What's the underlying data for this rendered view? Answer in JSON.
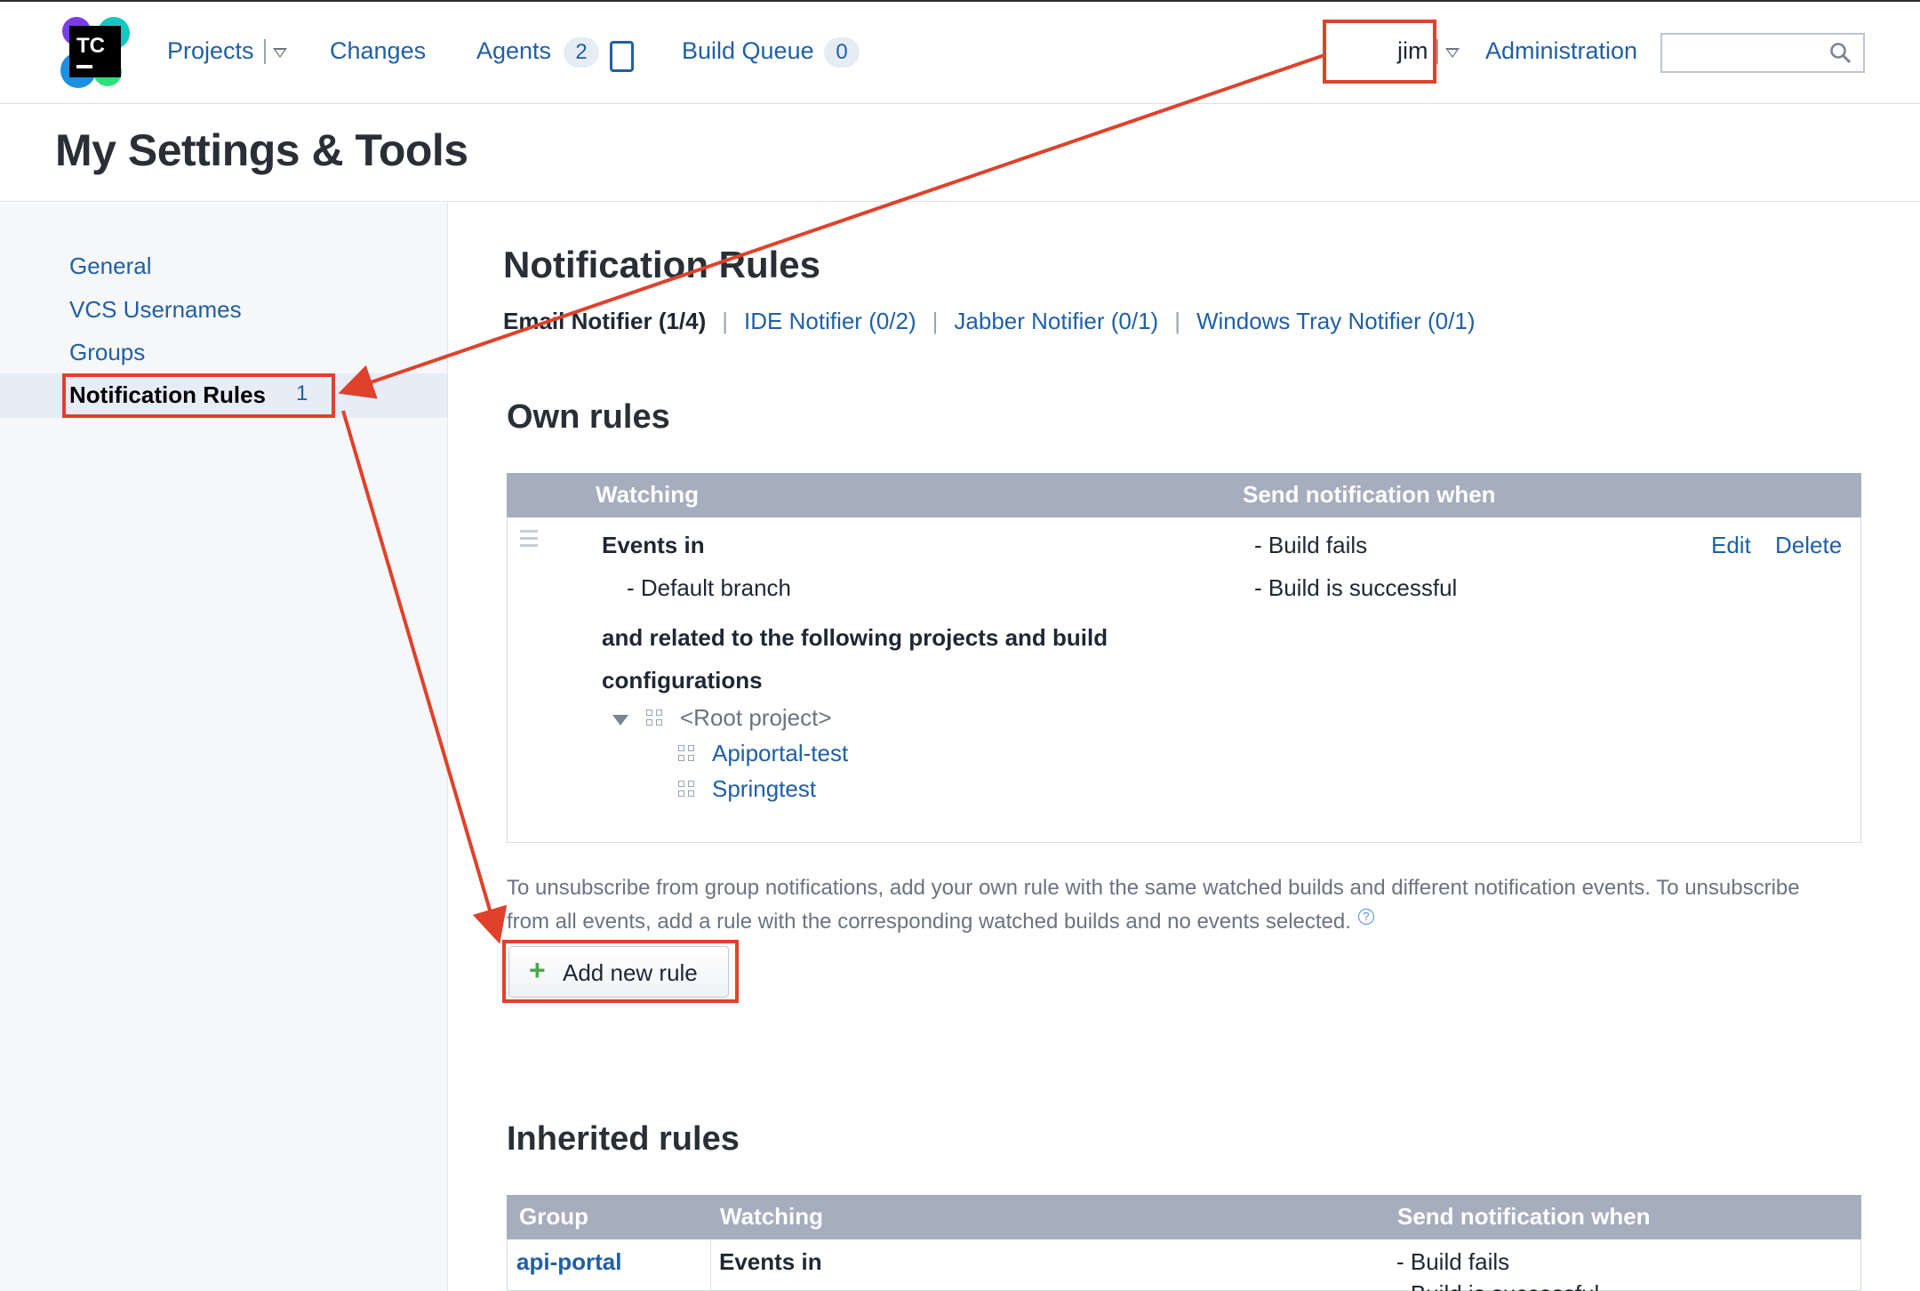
{
  "header": {
    "logo_text": "TC",
    "nav": {
      "projects": "Projects",
      "changes": "Changes",
      "agents": "Agents",
      "agents_count": "2",
      "build_queue": "Build Queue",
      "build_queue_count": "0"
    },
    "user": "jim",
    "administration": "Administration",
    "search_value": ""
  },
  "page": {
    "title": "My Settings & Tools"
  },
  "sidebar": {
    "items": [
      {
        "label": "General"
      },
      {
        "label": "VCS Usernames"
      },
      {
        "label": "Groups"
      },
      {
        "label": "Notification Rules",
        "count": "1",
        "active": true
      }
    ]
  },
  "main": {
    "heading": "Notification Rules",
    "tabs": [
      {
        "label": "Email Notifier (1/4)",
        "active": true
      },
      {
        "label": "IDE Notifier (0/2)"
      },
      {
        "label": "Jabber Notifier (0/1)"
      },
      {
        "label": "Windows Tray Notifier (0/1)"
      }
    ],
    "own_rules": {
      "heading": "Own rules",
      "columns": [
        "Watching",
        "Send notification when"
      ],
      "rule": {
        "events_in": "Events in",
        "branch": "- Default branch",
        "related_line1": "and related to the following projects and build",
        "related_line2": "configurations",
        "root_project": "<Root project>",
        "projects": [
          "Apiportal-test",
          "Springtest"
        ],
        "conditions": [
          "- Build fails",
          "- Build is successful"
        ],
        "edit": "Edit",
        "delete": "Delete"
      }
    },
    "hint": "To unsubscribe from group notifications, add your own rule with the same watched builds and different notification events. To unsubscribe from all events, add a rule with the corresponding watched builds and no events selected.",
    "help_icon": "?",
    "add_button": "Add new rule",
    "inherited_rules": {
      "heading": "Inherited rules",
      "columns": [
        "Group",
        "Watching",
        "Send notification when"
      ],
      "rows": [
        {
          "group": "api-portal",
          "watching": "Events in",
          "conditions": [
            "- Build fails",
            "- Build is successful"
          ]
        }
      ]
    }
  },
  "annotations": {
    "color": "#e0412b"
  }
}
